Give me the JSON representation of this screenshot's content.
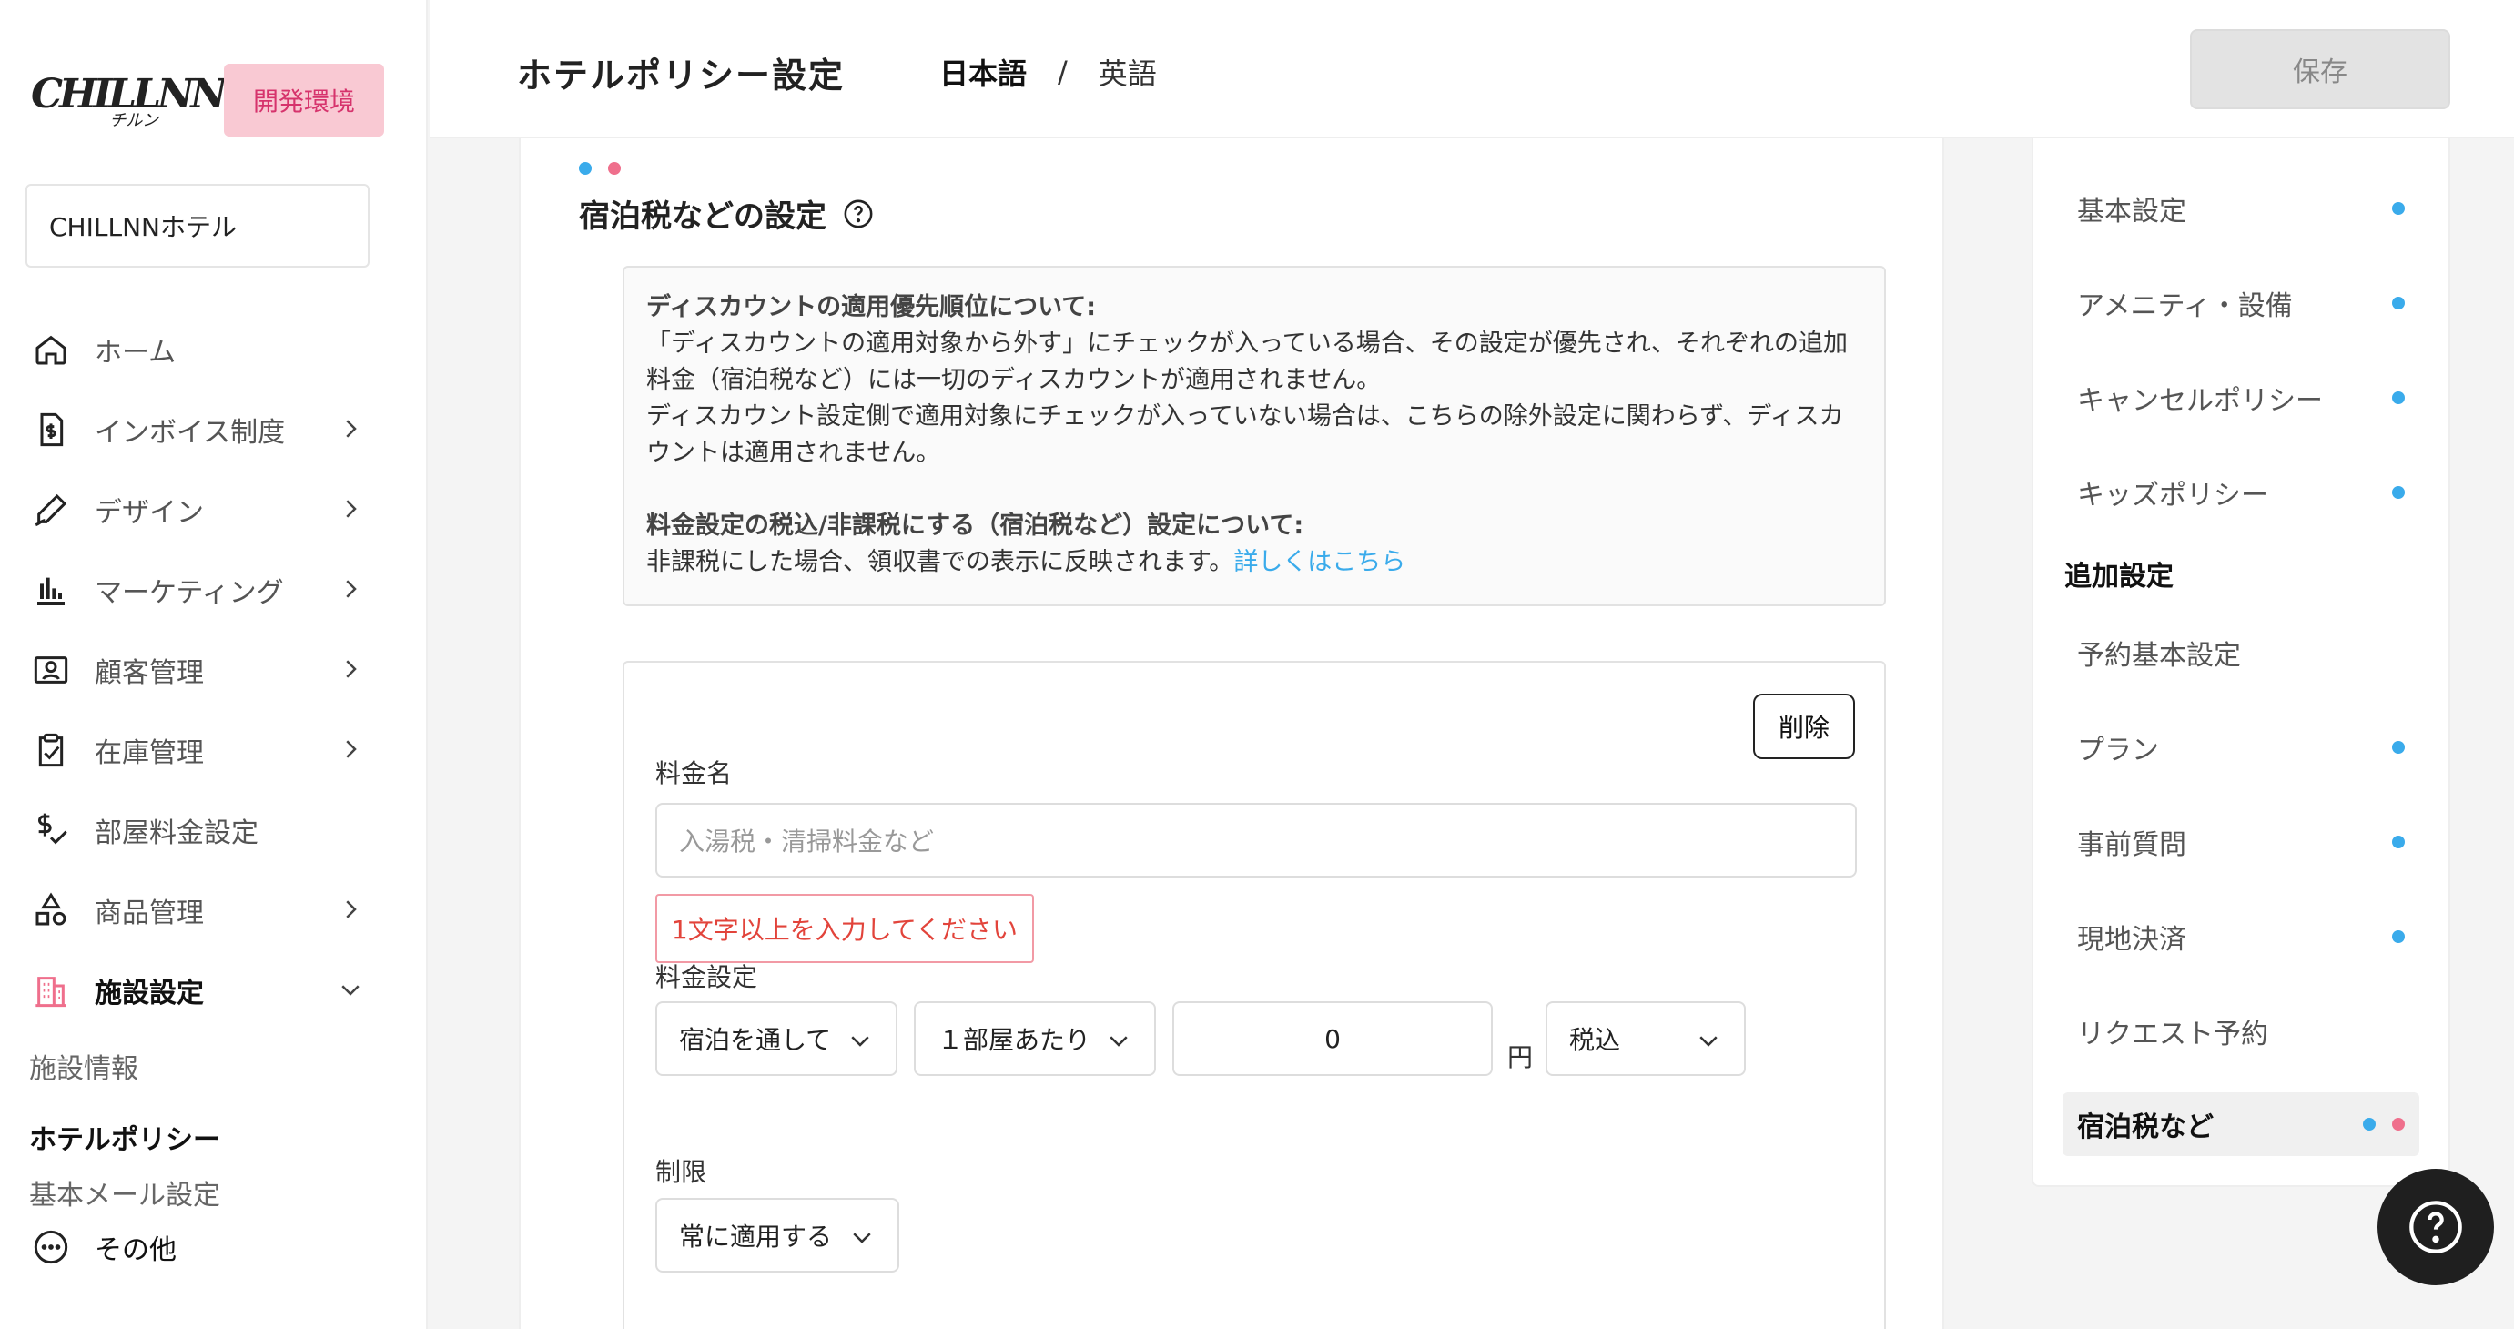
{
  "sidebar": {
    "logo": "CHILLNN",
    "logo_sub": "チルン",
    "env_badge": "開発環境",
    "hotel_name": "CHILLNNホテル",
    "nav": [
      {
        "label": "ホーム",
        "icon": "home-icon"
      },
      {
        "label": "インボイス制度",
        "icon": "invoice-icon"
      },
      {
        "label": "デザイン",
        "icon": "pen-icon"
      },
      {
        "label": "マーケティング",
        "icon": "bar-chart-icon"
      },
      {
        "label": "顧客管理",
        "icon": "contact-card-icon"
      },
      {
        "label": "在庫管理",
        "icon": "clipboard-check-icon"
      },
      {
        "label": "部屋料金設定",
        "icon": "dollar-check-icon"
      },
      {
        "label": "商品管理",
        "icon": "shapes-icon"
      },
      {
        "label": "施設設定",
        "icon": "building-icon"
      }
    ],
    "sub_items": [
      "施設情報",
      "ホテルポリシー",
      "基本メール設定"
    ],
    "other": "その他"
  },
  "header": {
    "title": "ホテルポリシー設定",
    "lang_ja": "日本語",
    "lang_sep": "/",
    "lang_en": "英語",
    "save_label": "保存"
  },
  "section": {
    "title": "宿泊税などの設定"
  },
  "notice": {
    "h1": "ディスカウントの適用優先順位について:",
    "p1": "「ディスカウントの適用対象から外す」にチェックが入っている場合、その設定が優先され、それぞれの追加料金（宿泊税など）には一切のディスカウントが適用されません。",
    "p2": "ディスカウント設定側で適用対象にチェックが入っていない場合は、こちらの除外設定に関わらず、ディスカウントは適用されません。",
    "h2": "料金設定の税込/非課税にする（宿泊税など）設定について:",
    "p3": "非課税にした場合、領収書での表示に反映されます。",
    "link": "詳しくはこちら"
  },
  "fee": {
    "delete_label": "削除",
    "name_label": "料金名",
    "name_placeholder": "入湯税・清掃料金など",
    "error": "1文字以上を入力してください",
    "price_label": "料金設定",
    "period": "宿泊を通して",
    "unit": "１部屋あたり",
    "amount": "0",
    "yen": "円",
    "tax": "税込",
    "limit_label": "制限",
    "limit": "常に適用する"
  },
  "right_nav": {
    "items_top": [
      "基本設定",
      "アメニティ・設備",
      "キャンセルポリシー",
      "キッズポリシー"
    ],
    "heading": "追加設定",
    "items_bottom": [
      "予約基本設定",
      "プラン",
      "事前質問",
      "現地決済",
      "リクエスト予約",
      "宿泊税など"
    ]
  },
  "colors": {
    "accent_blue": "#3aabeb",
    "accent_pink": "#ef6f8c",
    "error_red": "#e2443b",
    "env_badge_bg": "#f9c9d3"
  }
}
